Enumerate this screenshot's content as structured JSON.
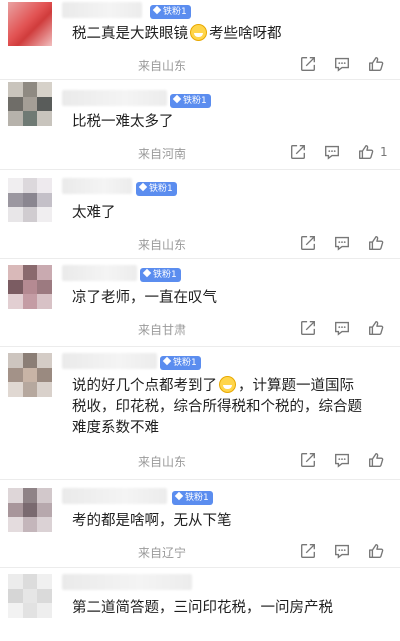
{
  "comments": [
    {
      "badge": "铁粉1",
      "text": "税二真是大跌眼镜",
      "emoji_after": true,
      "text_after": "考些啥呀都",
      "location": "来自山东",
      "likes": ""
    },
    {
      "badge": "铁粉1",
      "text": "比税一难太多了",
      "location": "来自河南",
      "likes": "1"
    },
    {
      "badge": "铁粉1",
      "text": "太难了",
      "location": "来自山东",
      "likes": ""
    },
    {
      "badge": "铁粉1",
      "text": "凉了老师，一直在叹气",
      "location": "来自甘肃",
      "likes": ""
    },
    {
      "badge": "铁粉1",
      "text_line1_a": "说的好几个点都考到了",
      "text_line1_b": "，计算题一道国际",
      "text_line2": "税收，印花税，综合所得税和个税的，综合题",
      "text_line3": "难度系数不难",
      "location": "来自山东",
      "likes": ""
    },
    {
      "badge": "铁粉1",
      "text": "考的都是啥啊，无从下笔",
      "location": "来自辽宁",
      "likes": ""
    },
    {
      "badge": "",
      "text": "第二道简答题，三问印花税，一问房产税",
      "location": "",
      "likes": ""
    }
  ],
  "icons": {
    "share": "share-icon",
    "comment": "comment-icon",
    "like": "thumbs-up-icon"
  },
  "colors": {
    "badge": "#5b8def",
    "location": "#9a9a9a",
    "divider": "#ececec"
  }
}
